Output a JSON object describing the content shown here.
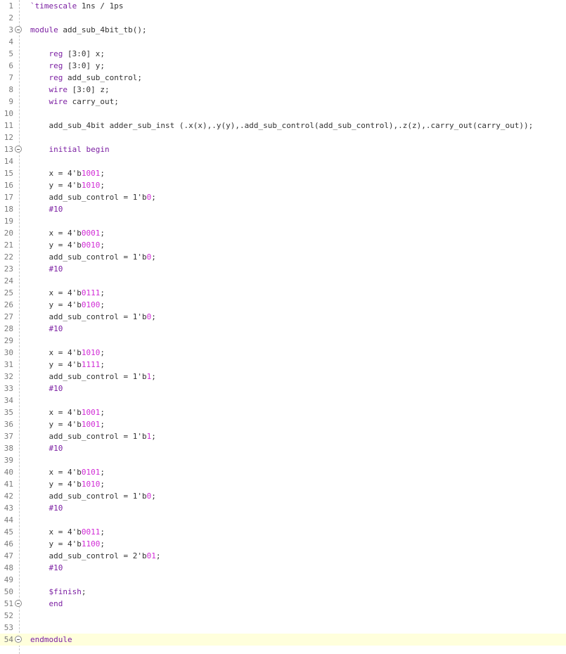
{
  "editor": {
    "language": "verilog",
    "current_line": 54,
    "colors": {
      "keyword": "#7b1fa2",
      "number": "#d12bd6",
      "text": "#333333",
      "line_number": "#7a7a7a",
      "current_line_bg": "#ffffdc"
    },
    "fold_lines": [
      3,
      13,
      51,
      54
    ],
    "lines": [
      [
        {
          "t": "kw",
          "v": "`timescale"
        },
        {
          "t": "plain",
          "v": " 1ns / 1ps"
        }
      ],
      [],
      [
        {
          "t": "kw",
          "v": "module"
        },
        {
          "t": "plain",
          "v": " add_sub_4bit_tb();"
        }
      ],
      [],
      [
        {
          "t": "plain",
          "v": "    "
        },
        {
          "t": "kw",
          "v": "reg"
        },
        {
          "t": "plain",
          "v": " [3:0] x;"
        }
      ],
      [
        {
          "t": "plain",
          "v": "    "
        },
        {
          "t": "kw",
          "v": "reg"
        },
        {
          "t": "plain",
          "v": " [3:0] y;"
        }
      ],
      [
        {
          "t": "plain",
          "v": "    "
        },
        {
          "t": "kw",
          "v": "reg"
        },
        {
          "t": "plain",
          "v": " add_sub_control;"
        }
      ],
      [
        {
          "t": "plain",
          "v": "    "
        },
        {
          "t": "kw",
          "v": "wire"
        },
        {
          "t": "plain",
          "v": " [3:0] z;"
        }
      ],
      [
        {
          "t": "plain",
          "v": "    "
        },
        {
          "t": "kw",
          "v": "wire"
        },
        {
          "t": "plain",
          "v": " carry_out;"
        }
      ],
      [],
      [
        {
          "t": "plain",
          "v": "    add_sub_4bit adder_sub_inst (.x(x),.y(y),.add_sub_control(add_sub_control),.z(z),.carry_out(carry_out));"
        }
      ],
      [],
      [
        {
          "t": "plain",
          "v": "    "
        },
        {
          "t": "kw",
          "v": "initial begin"
        }
      ],
      [],
      [
        {
          "t": "plain",
          "v": "    x = 4'b"
        },
        {
          "t": "num",
          "v": "1001"
        },
        {
          "t": "plain",
          "v": ";"
        }
      ],
      [
        {
          "t": "plain",
          "v": "    y = 4'b"
        },
        {
          "t": "num",
          "v": "1010"
        },
        {
          "t": "plain",
          "v": ";"
        }
      ],
      [
        {
          "t": "plain",
          "v": "    add_sub_control = 1'b"
        },
        {
          "t": "num",
          "v": "0"
        },
        {
          "t": "plain",
          "v": ";"
        }
      ],
      [
        {
          "t": "plain",
          "v": "    "
        },
        {
          "t": "kw",
          "v": "#10"
        }
      ],
      [],
      [
        {
          "t": "plain",
          "v": "    x = 4'b"
        },
        {
          "t": "num",
          "v": "0001"
        },
        {
          "t": "plain",
          "v": ";"
        }
      ],
      [
        {
          "t": "plain",
          "v": "    y = 4'b"
        },
        {
          "t": "num",
          "v": "0010"
        },
        {
          "t": "plain",
          "v": ";"
        }
      ],
      [
        {
          "t": "plain",
          "v": "    add_sub_control = 1'b"
        },
        {
          "t": "num",
          "v": "0"
        },
        {
          "t": "plain",
          "v": ";"
        }
      ],
      [
        {
          "t": "plain",
          "v": "    "
        },
        {
          "t": "kw",
          "v": "#10"
        }
      ],
      [],
      [
        {
          "t": "plain",
          "v": "    x = 4'b"
        },
        {
          "t": "num",
          "v": "0111"
        },
        {
          "t": "plain",
          "v": ";"
        }
      ],
      [
        {
          "t": "plain",
          "v": "    y = 4'b"
        },
        {
          "t": "num",
          "v": "0100"
        },
        {
          "t": "plain",
          "v": ";"
        }
      ],
      [
        {
          "t": "plain",
          "v": "    add_sub_control = 1'b"
        },
        {
          "t": "num",
          "v": "0"
        },
        {
          "t": "plain",
          "v": ";"
        }
      ],
      [
        {
          "t": "plain",
          "v": "    "
        },
        {
          "t": "kw",
          "v": "#10"
        }
      ],
      [],
      [
        {
          "t": "plain",
          "v": "    x = 4'b"
        },
        {
          "t": "num",
          "v": "1010"
        },
        {
          "t": "plain",
          "v": ";"
        }
      ],
      [
        {
          "t": "plain",
          "v": "    y = 4'b"
        },
        {
          "t": "num",
          "v": "1111"
        },
        {
          "t": "plain",
          "v": ";"
        }
      ],
      [
        {
          "t": "plain",
          "v": "    add_sub_control = 1'b"
        },
        {
          "t": "num",
          "v": "1"
        },
        {
          "t": "plain",
          "v": ";"
        }
      ],
      [
        {
          "t": "plain",
          "v": "    "
        },
        {
          "t": "kw",
          "v": "#10"
        }
      ],
      [],
      [
        {
          "t": "plain",
          "v": "    x = 4'b"
        },
        {
          "t": "num",
          "v": "1001"
        },
        {
          "t": "plain",
          "v": ";"
        }
      ],
      [
        {
          "t": "plain",
          "v": "    y = 4'b"
        },
        {
          "t": "num",
          "v": "1001"
        },
        {
          "t": "plain",
          "v": ";"
        }
      ],
      [
        {
          "t": "plain",
          "v": "    add_sub_control = 1'b"
        },
        {
          "t": "num",
          "v": "1"
        },
        {
          "t": "plain",
          "v": ";"
        }
      ],
      [
        {
          "t": "plain",
          "v": "    "
        },
        {
          "t": "kw",
          "v": "#10"
        }
      ],
      [],
      [
        {
          "t": "plain",
          "v": "    x = 4'b"
        },
        {
          "t": "num",
          "v": "0101"
        },
        {
          "t": "plain",
          "v": ";"
        }
      ],
      [
        {
          "t": "plain",
          "v": "    y = 4'b"
        },
        {
          "t": "num",
          "v": "1010"
        },
        {
          "t": "plain",
          "v": ";"
        }
      ],
      [
        {
          "t": "plain",
          "v": "    add_sub_control = 1'b"
        },
        {
          "t": "num",
          "v": "0"
        },
        {
          "t": "plain",
          "v": ";"
        }
      ],
      [
        {
          "t": "plain",
          "v": "    "
        },
        {
          "t": "kw",
          "v": "#10"
        }
      ],
      [],
      [
        {
          "t": "plain",
          "v": "    x = 4'b"
        },
        {
          "t": "num",
          "v": "0011"
        },
        {
          "t": "plain",
          "v": ";"
        }
      ],
      [
        {
          "t": "plain",
          "v": "    y = 4'b"
        },
        {
          "t": "num",
          "v": "1100"
        },
        {
          "t": "plain",
          "v": ";"
        }
      ],
      [
        {
          "t": "plain",
          "v": "    add_sub_control = 2'b"
        },
        {
          "t": "num",
          "v": "01"
        },
        {
          "t": "plain",
          "v": ";"
        }
      ],
      [
        {
          "t": "plain",
          "v": "    "
        },
        {
          "t": "kw",
          "v": "#10"
        }
      ],
      [],
      [
        {
          "t": "plain",
          "v": "    "
        },
        {
          "t": "kw",
          "v": "$finish"
        },
        {
          "t": "plain",
          "v": ";"
        }
      ],
      [
        {
          "t": "plain",
          "v": "    "
        },
        {
          "t": "kw",
          "v": "end"
        }
      ],
      [],
      [],
      [
        {
          "t": "kw",
          "v": "endmodule"
        }
      ]
    ]
  }
}
